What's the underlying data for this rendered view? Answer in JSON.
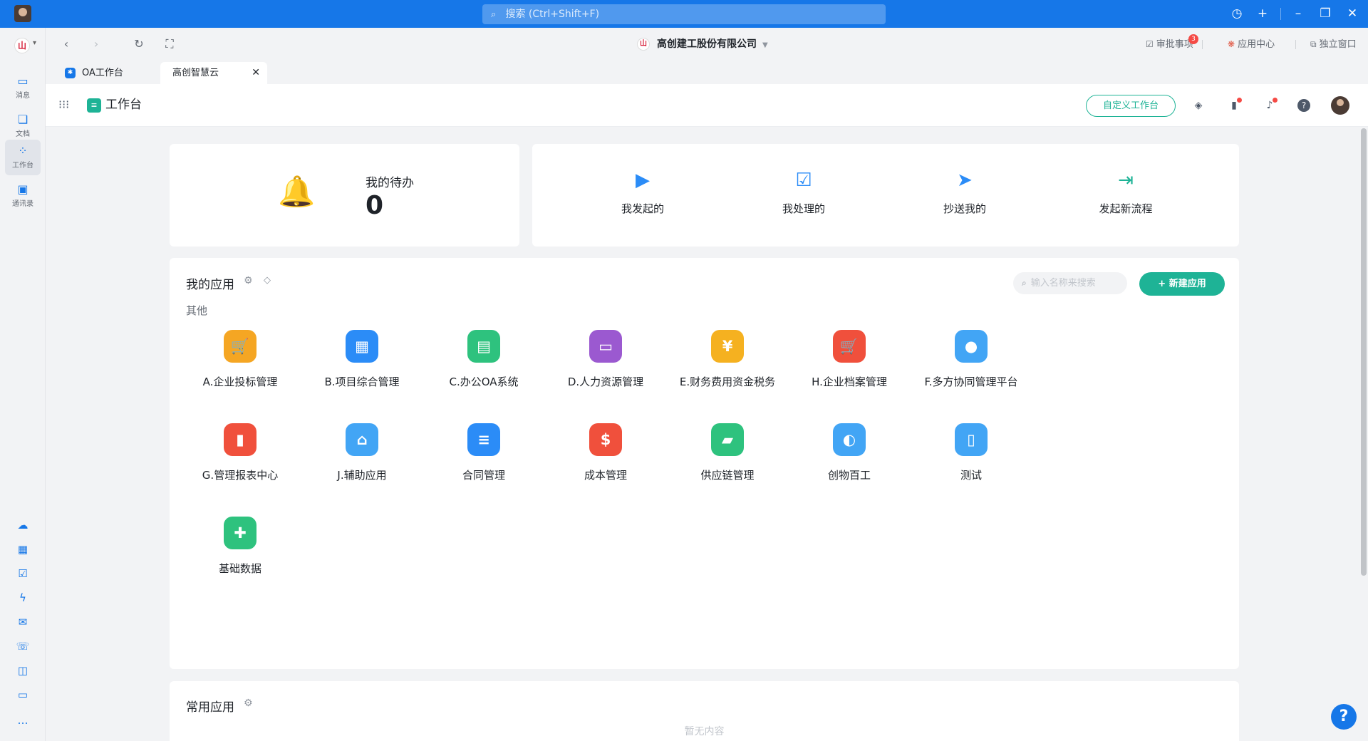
{
  "titlebar": {
    "search_placeholder": "搜索 (Ctrl+Shift+F)"
  },
  "rail": {
    "items": [
      {
        "label": "消息",
        "icon": "message-icon"
      },
      {
        "label": "文档",
        "icon": "document-icon"
      },
      {
        "label": "工作台",
        "icon": "workbench-icon"
      },
      {
        "label": "通讯录",
        "icon": "contacts-icon"
      }
    ]
  },
  "nav": {
    "company": "高创建工股份有限公司",
    "approval": "审批事项",
    "approval_badge": "3",
    "app_center": "应用中心",
    "standalone": "独立窗口"
  },
  "tabs": [
    {
      "label": "OA工作台"
    },
    {
      "label": "高创智慧云"
    }
  ],
  "header": {
    "title": "工作台",
    "custom_button": "自定义工作台"
  },
  "todo": {
    "label": "我的待办",
    "count": "0"
  },
  "quick": [
    {
      "label": "我发起的",
      "icon": "play-circle-icon",
      "color": "#2b8cf7"
    },
    {
      "label": "我处理的",
      "icon": "checklist-icon",
      "color": "#2b8cf7"
    },
    {
      "label": "抄送我的",
      "icon": "paper-plane-icon",
      "color": "#2b8cf7"
    },
    {
      "label": "发起新流程",
      "icon": "flow-start-icon",
      "color": "#1eb396"
    }
  ],
  "apps": {
    "title": "我的应用",
    "search_placeholder": "输入名称来搜索",
    "new_button": "新建应用",
    "group": "其他",
    "items": [
      {
        "label": "A.企业投标管理",
        "icon": "cart-icon",
        "color": "#f5a623",
        "glyph": "🛒"
      },
      {
        "label": "B.项目综合管理",
        "icon": "building-icon",
        "color": "#2b8cf7",
        "glyph": "▦"
      },
      {
        "label": "C.办公OA系统",
        "icon": "briefcase-icon",
        "color": "#2ec27e",
        "glyph": "▤"
      },
      {
        "label": "D.人力资源管理",
        "icon": "id-card-icon",
        "color": "#9b59d0",
        "glyph": "▭"
      },
      {
        "label": "E.财务费用资金税务",
        "icon": "yuan-icon",
        "color": "#f5b120",
        "glyph": "¥"
      },
      {
        "label": "H.企业档案管理",
        "icon": "cart-icon",
        "color": "#f0503c",
        "glyph": "🛒"
      },
      {
        "label": "F.多方协同管理平台",
        "icon": "crm-icon",
        "color": "#42a5f5",
        "glyph": "●"
      },
      {
        "label": "G.管理报表中心",
        "icon": "bar-chart-icon",
        "color": "#f0503c",
        "glyph": "▮"
      },
      {
        "label": "J.辅助应用",
        "icon": "store-icon",
        "color": "#42a5f5",
        "glyph": "⌂"
      },
      {
        "label": "合同管理",
        "icon": "file-icon",
        "color": "#2b8cf7",
        "glyph": "≡"
      },
      {
        "label": "成本管理",
        "icon": "money-bag-icon",
        "color": "#f0503c",
        "glyph": "$"
      },
      {
        "label": "供应链管理",
        "icon": "truck-icon",
        "color": "#2ec27e",
        "glyph": "▰"
      },
      {
        "label": "创物百工",
        "icon": "planet-icon",
        "color": "#42a5f5",
        "glyph": "◐"
      },
      {
        "label": "测试",
        "icon": "columns-icon",
        "color": "#42a5f5",
        "glyph": "▯"
      },
      {
        "label": "基础数据",
        "icon": "puzzle-icon",
        "color": "#2ec27e",
        "glyph": "✚"
      }
    ]
  },
  "common": {
    "title": "常用应用",
    "empty": "暂无内容"
  }
}
